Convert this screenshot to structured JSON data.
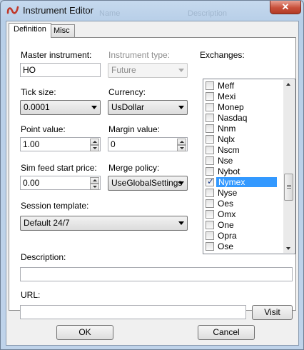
{
  "window": {
    "title": "Instrument Editor",
    "close_glyph": "✕",
    "ghost_name": "Name",
    "ghost_description": "Description"
  },
  "tabs": [
    {
      "label": "Definition",
      "active": true
    },
    {
      "label": "Misc",
      "active": false
    }
  ],
  "form": {
    "master_instrument": {
      "label": "Master instrument:",
      "value": "HO"
    },
    "instrument_type": {
      "label": "Instrument type:",
      "value": "Future",
      "enabled": false
    },
    "tick_size": {
      "label": "Tick size:",
      "value": "0.0001"
    },
    "currency": {
      "label": "Currency:",
      "value": "UsDollar"
    },
    "point_value": {
      "label": "Point value:",
      "value": "1.00"
    },
    "margin_value": {
      "label": "Margin value:",
      "value": "0"
    },
    "sim_feed_start_price": {
      "label": "Sim feed start price:",
      "value": "0.00"
    },
    "merge_policy": {
      "label": "Merge policy:",
      "value": "UseGlobalSettings"
    },
    "session_template": {
      "label": "Session template:",
      "value": "Default 24/7"
    },
    "description": {
      "label": "Description:",
      "value": ""
    },
    "url": {
      "label": "URL:",
      "value": "",
      "visit_label": "Visit"
    }
  },
  "exchanges": {
    "label": "Exchanges:",
    "items": [
      {
        "label": "Meff",
        "checked": false,
        "selected": false
      },
      {
        "label": "Mexi",
        "checked": false,
        "selected": false
      },
      {
        "label": "Monep",
        "checked": false,
        "selected": false
      },
      {
        "label": "Nasdaq",
        "checked": false,
        "selected": false
      },
      {
        "label": "Nnm",
        "checked": false,
        "selected": false
      },
      {
        "label": "Nqlx",
        "checked": false,
        "selected": false
      },
      {
        "label": "Nscm",
        "checked": false,
        "selected": false
      },
      {
        "label": "Nse",
        "checked": false,
        "selected": false
      },
      {
        "label": "Nybot",
        "checked": false,
        "selected": false
      },
      {
        "label": "Nymex",
        "checked": true,
        "selected": true
      },
      {
        "label": "Nyse",
        "checked": false,
        "selected": false
      },
      {
        "label": "Oes",
        "checked": false,
        "selected": false
      },
      {
        "label": "Omx",
        "checked": false,
        "selected": false
      },
      {
        "label": "One",
        "checked": false,
        "selected": false
      },
      {
        "label": "Opra",
        "checked": false,
        "selected": false
      },
      {
        "label": "Ose",
        "checked": false,
        "selected": false
      }
    ]
  },
  "footer": {
    "ok_label": "OK",
    "cancel_label": "Cancel"
  },
  "colors": {
    "selection": "#3399ff",
    "titlebar": "#c6d9ee",
    "close_button": "#c8503b",
    "logo": "#c0392b"
  },
  "icons": {
    "app": "ninja-logo-icon",
    "close": "close-icon",
    "checkmark": "checkmark-icon"
  }
}
